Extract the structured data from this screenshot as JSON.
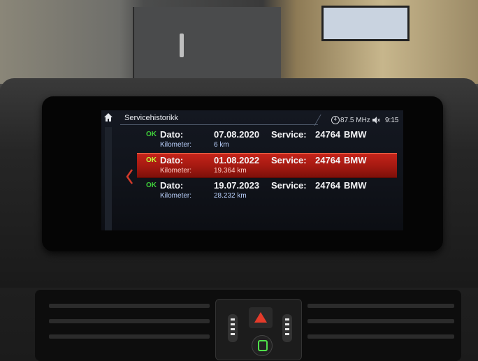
{
  "header": {
    "title": "Servicehistorikk",
    "radio_frequency": "87.5 MHz",
    "time": "9:15"
  },
  "service_entries": [
    {
      "status": "OK",
      "date_label": "Dato:",
      "date": "07.08.2020",
      "km_label": "Kilometer:",
      "km": "6 km",
      "service_label": "Service:",
      "service_code": "24764",
      "brand": "BMW",
      "selected": false
    },
    {
      "status": "OK",
      "date_label": "Dato:",
      "date": "01.08.2022",
      "km_label": "Kilometer:",
      "km": "19.364 km",
      "service_label": "Service:",
      "service_code": "24764",
      "brand": "BMW",
      "selected": true
    },
    {
      "status": "OK",
      "date_label": "Dato:",
      "date": "19.07.2023",
      "km_label": "Kilometer:",
      "km": "28.232 km",
      "service_label": "Service:",
      "service_code": "24764",
      "brand": "BMW",
      "selected": false
    }
  ],
  "icons": {
    "home": "home-icon",
    "back": "chevron-left-icon",
    "radio": "radio-icon",
    "mute": "speaker-mute-icon"
  },
  "colors": {
    "selection": "#c5241a",
    "ok": "#3fd13a",
    "accent": "#d33a2a"
  }
}
